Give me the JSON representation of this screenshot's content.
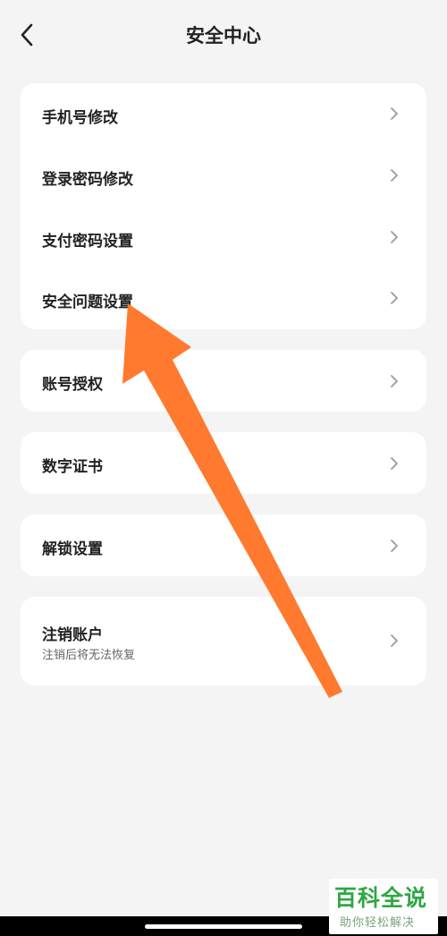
{
  "header": {
    "title": "安全中心",
    "back_icon": "chevron-left-icon"
  },
  "groups": {
    "security": {
      "items": [
        {
          "label": "手机号修改"
        },
        {
          "label": "登录密码修改"
        },
        {
          "label": "支付密码设置"
        },
        {
          "label": "安全问题设置"
        }
      ]
    },
    "authorization": {
      "label": "账号授权"
    },
    "certificate": {
      "label": "数字证书"
    },
    "unlock": {
      "label": "解锁设置"
    },
    "cancel": {
      "label": "注销账户",
      "sublabel": "注销后将无法恢复"
    }
  },
  "annotation": {
    "arrow_color": "#ff7a2e"
  },
  "watermark": {
    "title": "百科全说",
    "subtitle": "助你轻松解决"
  },
  "colors": {
    "background": "#f4f4f4",
    "card": "#ffffff",
    "watermark_green": "#2fa744"
  }
}
